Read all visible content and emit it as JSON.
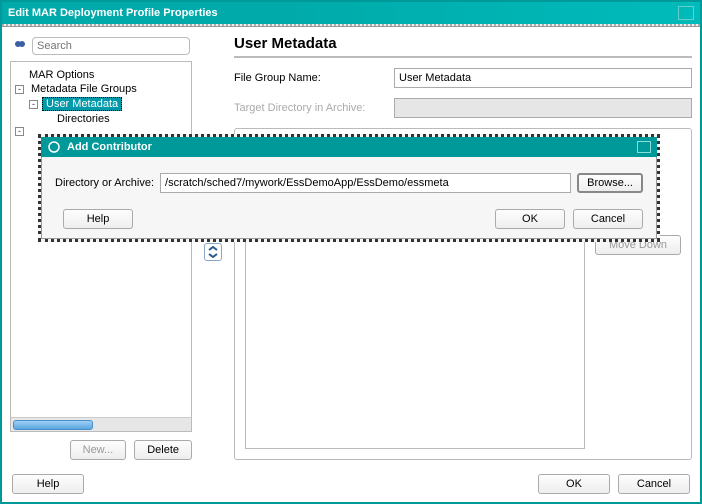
{
  "window": {
    "title": "Edit MAR Deployment Profile Properties"
  },
  "left": {
    "search_placeholder": "Search",
    "tree": {
      "root": "MAR Options",
      "group": "Metadata File Groups",
      "user_metadata": "User Metadata",
      "directories": "Directories"
    },
    "new_button": "New...",
    "delete_button": "Delete"
  },
  "right": {
    "section_title": "User Metadata",
    "file_group_label": "File Group Name:",
    "file_group_value": "User Metadata",
    "target_dir_label": "Target Directory in Archive:",
    "target_dir_value": "",
    "move_down": "Move Down"
  },
  "bottom": {
    "help": "Help",
    "ok": "OK",
    "cancel": "Cancel"
  },
  "modal": {
    "title": "Add Contributor",
    "dir_label": "Directory or Archive:",
    "dir_value": "/scratch/sched7/mywork/EssDemoApp/EssDemo/essmeta",
    "browse": "Browse...",
    "help": "Help",
    "ok": "OK",
    "cancel": "Cancel"
  }
}
